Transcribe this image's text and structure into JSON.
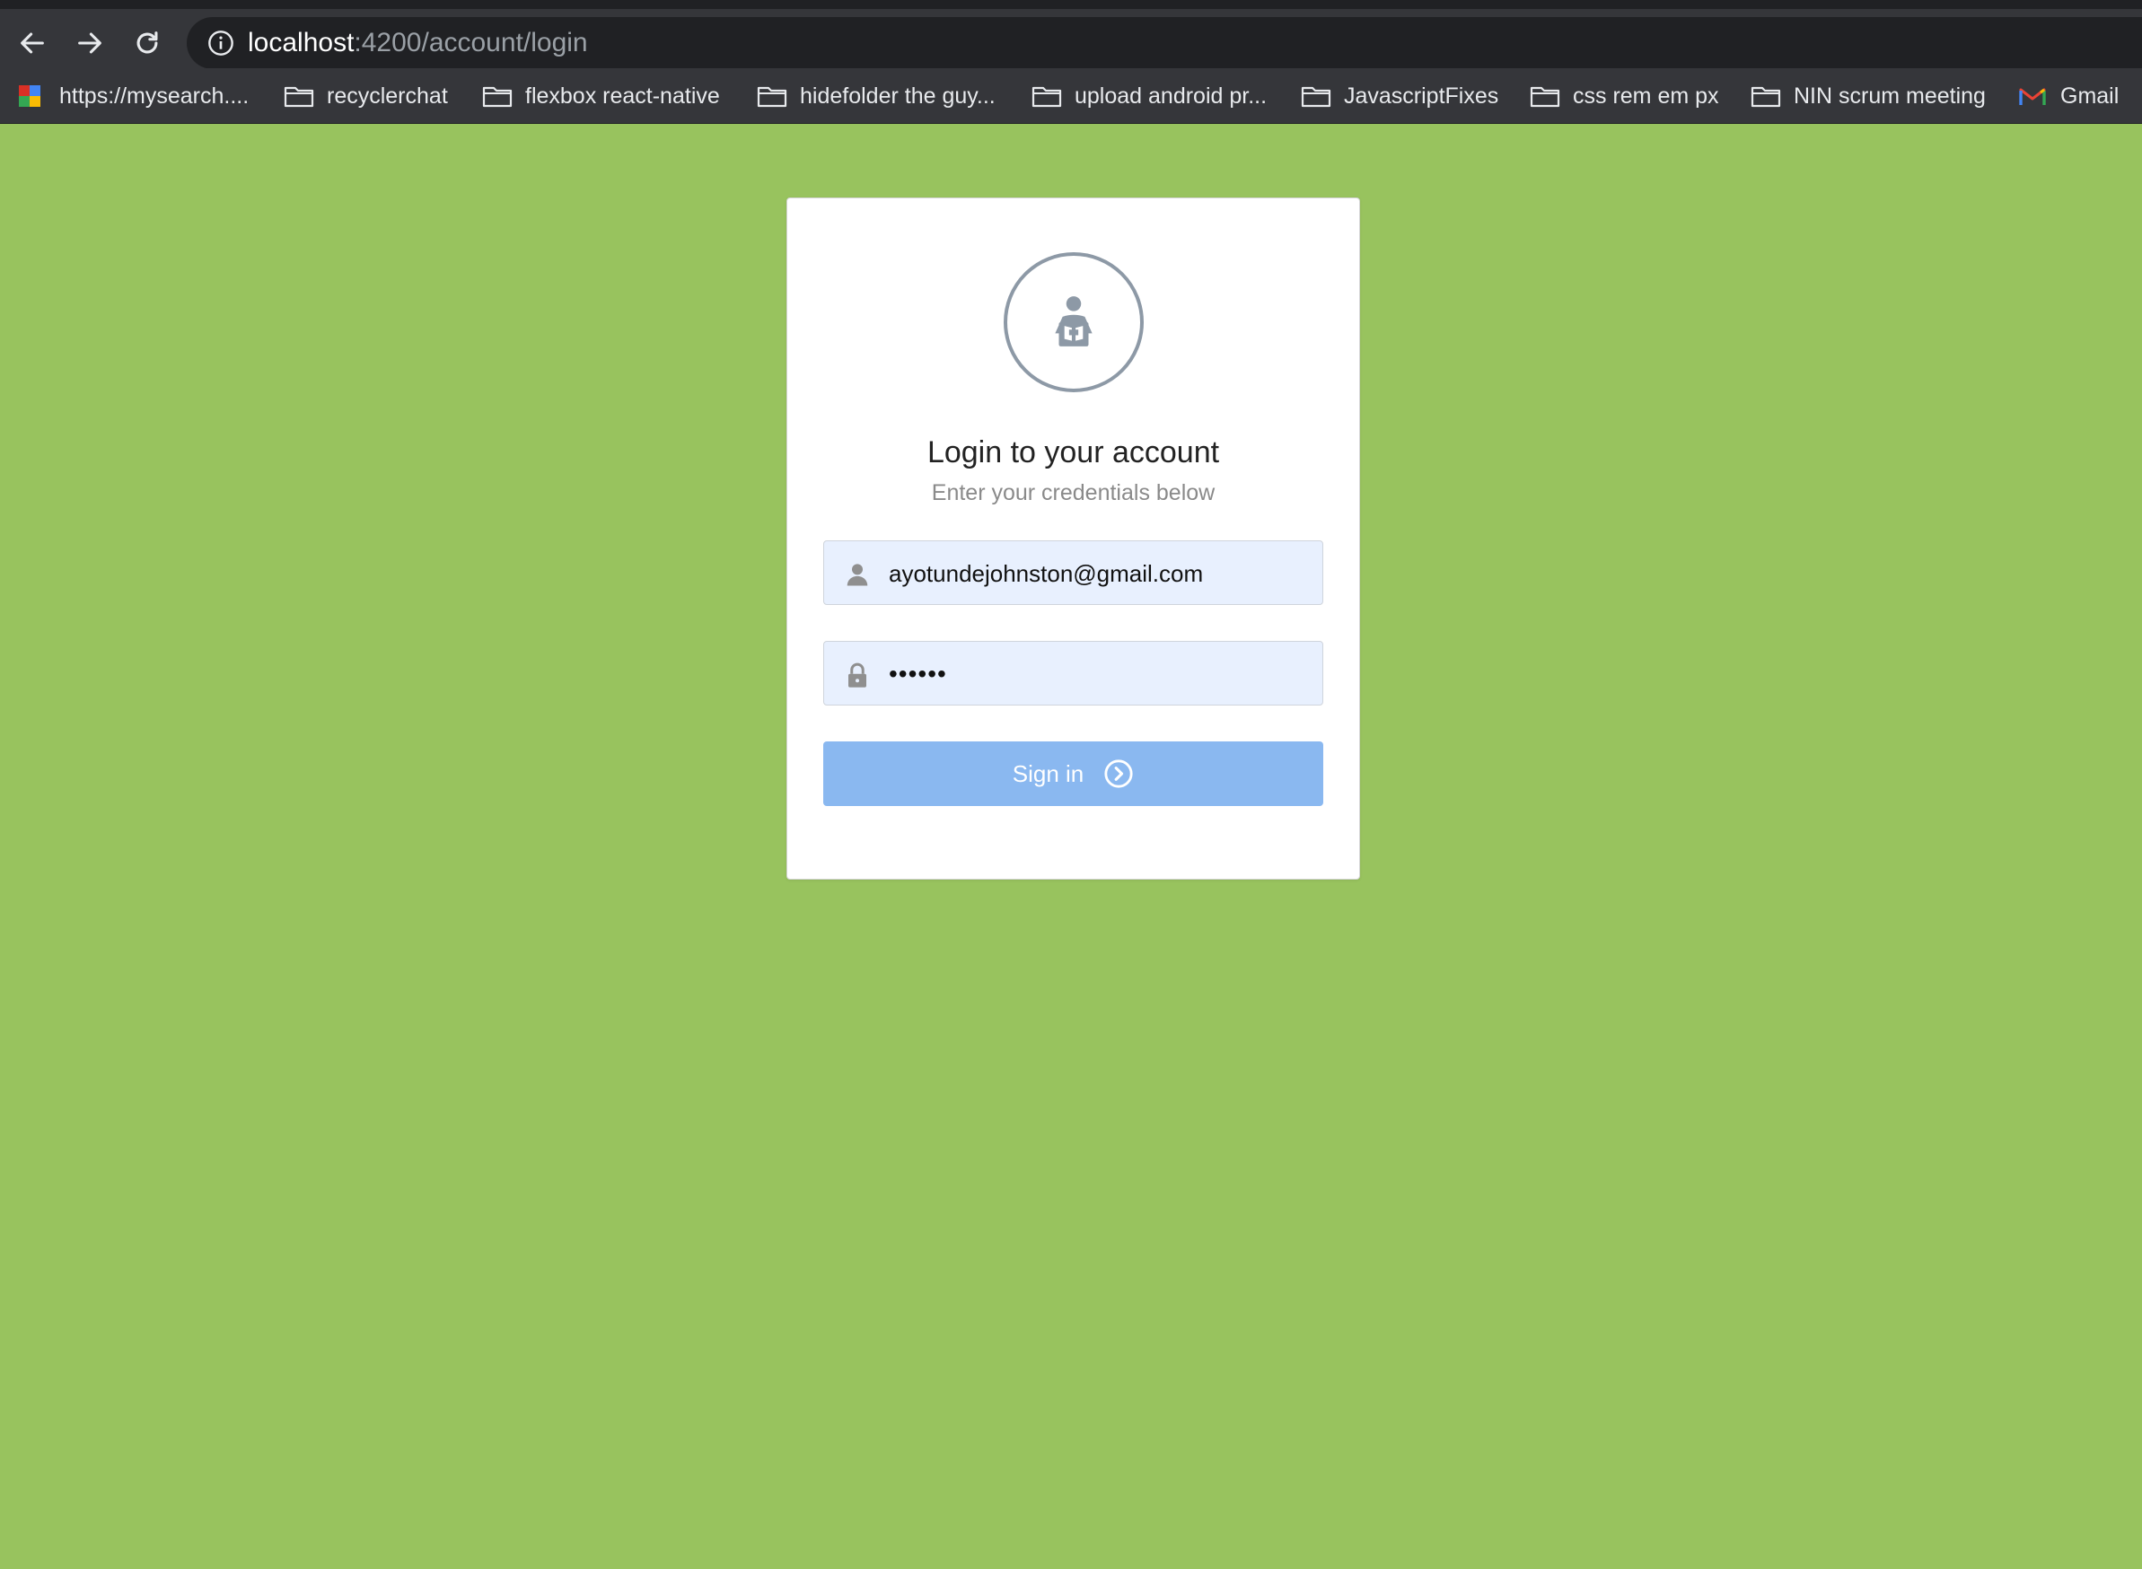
{
  "browser": {
    "url_host": "localhost",
    "url_path": ":4200/account/login",
    "nav": {
      "back_icon": "arrow-left-icon",
      "forward_icon": "arrow-right-icon",
      "reload_icon": "reload-icon"
    },
    "bookmarks": [
      {
        "label": "https://mysearch....",
        "icon": "site-favicon"
      },
      {
        "label": "recyclerchat",
        "icon": "folder-icon"
      },
      {
        "label": "flexbox react-native",
        "icon": "folder-icon"
      },
      {
        "label": "hidefolder the guy...",
        "icon": "folder-icon"
      },
      {
        "label": "upload android pr...",
        "icon": "folder-icon"
      },
      {
        "label": "JavascriptFixes",
        "icon": "folder-icon"
      },
      {
        "label": "css rem em px",
        "icon": "folder-icon"
      },
      {
        "label": "NIN scrum meeting",
        "icon": "folder-icon"
      },
      {
        "label": "Gmail",
        "icon": "gmail-icon"
      }
    ]
  },
  "login": {
    "title": "Login to your account",
    "subtitle": "Enter your credentials below",
    "email_value": "ayotundejohnston@gmail.com",
    "password_value": "••••••",
    "signin_label": "Sign in",
    "avatar_icon": "user-reading-icon"
  },
  "colors": {
    "background": "#98c35e",
    "button": "#8ab8f0",
    "field_bg": "#e8f0fe",
    "avatar_ring": "#8d99a6"
  }
}
